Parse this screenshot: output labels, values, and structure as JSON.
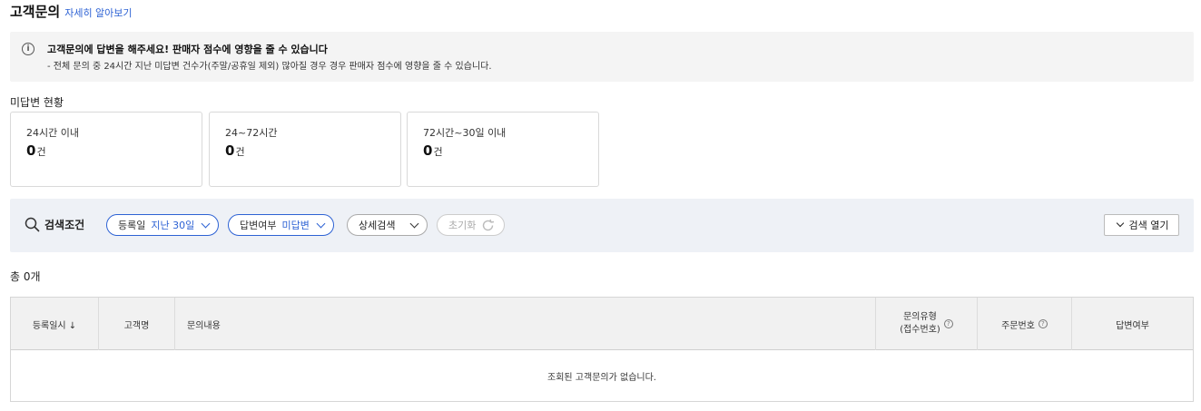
{
  "header": {
    "title": "고객문의",
    "learn_more": "자세히 알아보기"
  },
  "notice": {
    "title": "고객문의에 답변을 해주세요! 판매자 점수에 영향을 줄 수 있습니다",
    "description": "- 전체 문의 중 24시간 지난 미답변 건수가(주말/공휴일 제외) 많아질 경우 경우 판매자 점수에 영향을 줄 수 있습니다."
  },
  "unanswered": {
    "label": "미답변 현황",
    "cards": [
      {
        "label": "24시간 이내",
        "value": "0",
        "unit": "건"
      },
      {
        "label": "24~72시간",
        "value": "0",
        "unit": "건"
      },
      {
        "label": "72시간~30일 이내",
        "value": "0",
        "unit": "건"
      }
    ]
  },
  "search": {
    "label": "검색조건",
    "filters": [
      {
        "key": "등록일",
        "value": "지난 30일"
      },
      {
        "key": "답변여부",
        "value": "미답변"
      }
    ],
    "detail_label": "상세검색",
    "reset_label": "초기화",
    "open_label": "검색 열기"
  },
  "total_label": "총 0개",
  "table": {
    "columns": [
      "등록일시 ↓",
      "고객명",
      "문의내용",
      "문의유형",
      "(접수번호)",
      "주문번호",
      "답변여부"
    ],
    "empty_message": "조회된 고객문의가 없습니다."
  },
  "colors": {
    "accent": "#2d62d4",
    "notice_bg": "#f4f4f4",
    "search_bg": "#eef1f6"
  }
}
